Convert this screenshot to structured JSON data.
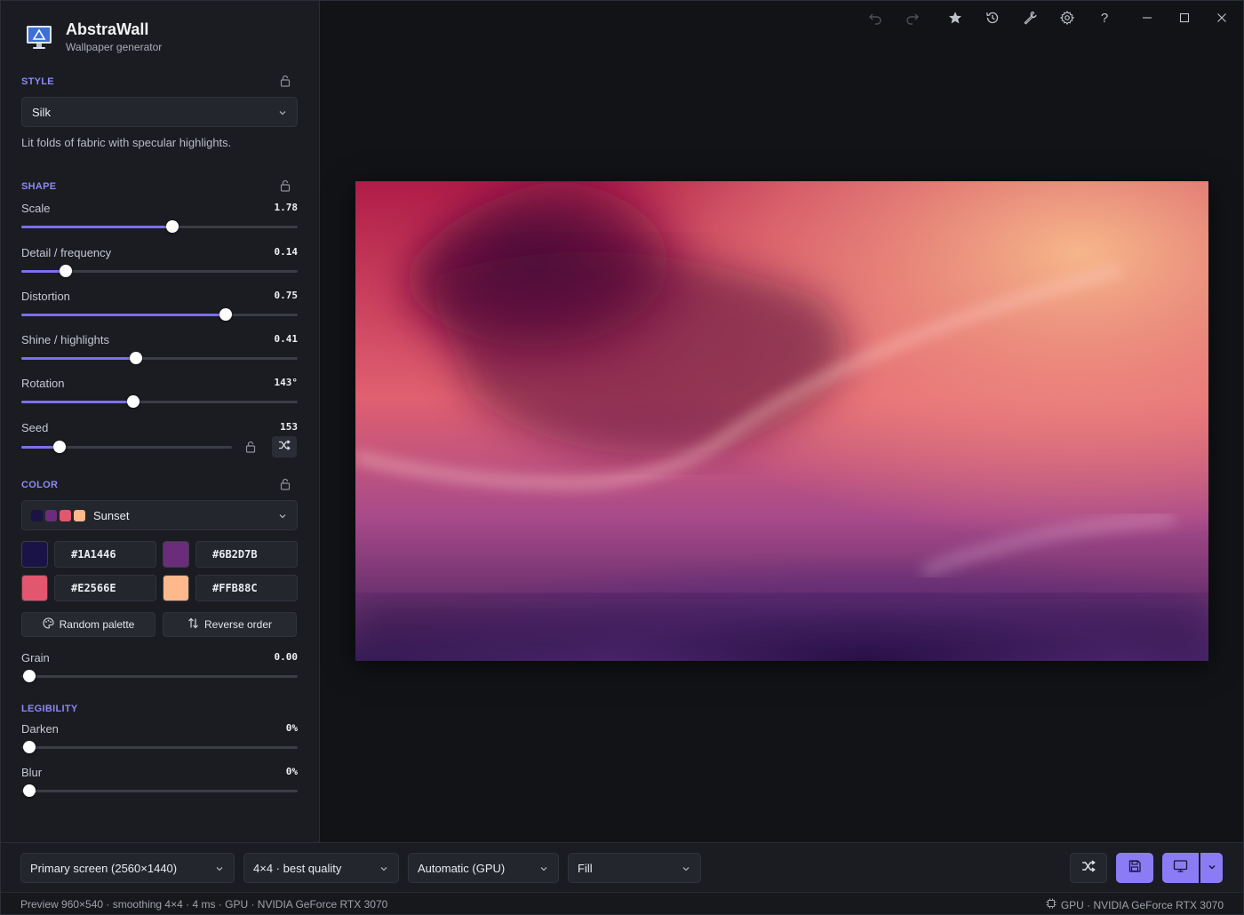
{
  "app": {
    "title": "AbstraWall",
    "subtitle": "Wallpaper generator"
  },
  "style": {
    "section_label": "STYLE",
    "selected": "Silk",
    "description": "Lit folds of fabric with specular highlights."
  },
  "shape": {
    "section_label": "SHAPE",
    "sliders": [
      {
        "label": "Scale",
        "value": "1.78",
        "fraction": 0.548
      },
      {
        "label": "Detail / frequency",
        "value": "0.14",
        "fraction": 0.16
      },
      {
        "label": "Distortion",
        "value": "0.75",
        "fraction": 0.738
      },
      {
        "label": "Shine / highlights",
        "value": "0.41",
        "fraction": 0.416
      },
      {
        "label": "Rotation",
        "value": "143°",
        "fraction": 0.405
      },
      {
        "label": "Seed",
        "value": "153",
        "fraction": 0.18
      }
    ]
  },
  "color": {
    "section_label": "COLOR",
    "palette_name": "Sunset",
    "palette_swatches": [
      "#1A1446",
      "#6B2D7B",
      "#E2566E",
      "#FFB88C"
    ],
    "colors": [
      "#1A1446",
      "#6B2D7B",
      "#E2566E",
      "#FFB88C"
    ],
    "random_palette_label": "Random palette",
    "reverse_order_label": "Reverse order",
    "grain": {
      "label": "Grain",
      "value": "0.00",
      "fraction": 0.0
    }
  },
  "legibility": {
    "section_label": "LEGIBILITY",
    "sliders": [
      {
        "label": "Darken",
        "value": "0%",
        "fraction": 0.0
      },
      {
        "label": "Blur",
        "value": "0%",
        "fraction": 0.0
      }
    ]
  },
  "toolbar": {
    "icons": [
      "undo-icon",
      "redo-icon",
      "star-icon",
      "history-icon",
      "wrench-icon",
      "gear-icon",
      "help-icon"
    ],
    "help_glyph": "?"
  },
  "bottom": {
    "screen": "Primary screen (2560×1440)",
    "quality": "4×4 · best quality",
    "renderer": "Automatic (GPU)",
    "fit": "Fill"
  },
  "status": {
    "left": "Preview 960×540 · smoothing 4×4 · 4 ms · GPU · NVIDIA GeForce RTX 3070",
    "right": "GPU · NVIDIA GeForce RTX 3070"
  },
  "accent": "#7d6ff0"
}
